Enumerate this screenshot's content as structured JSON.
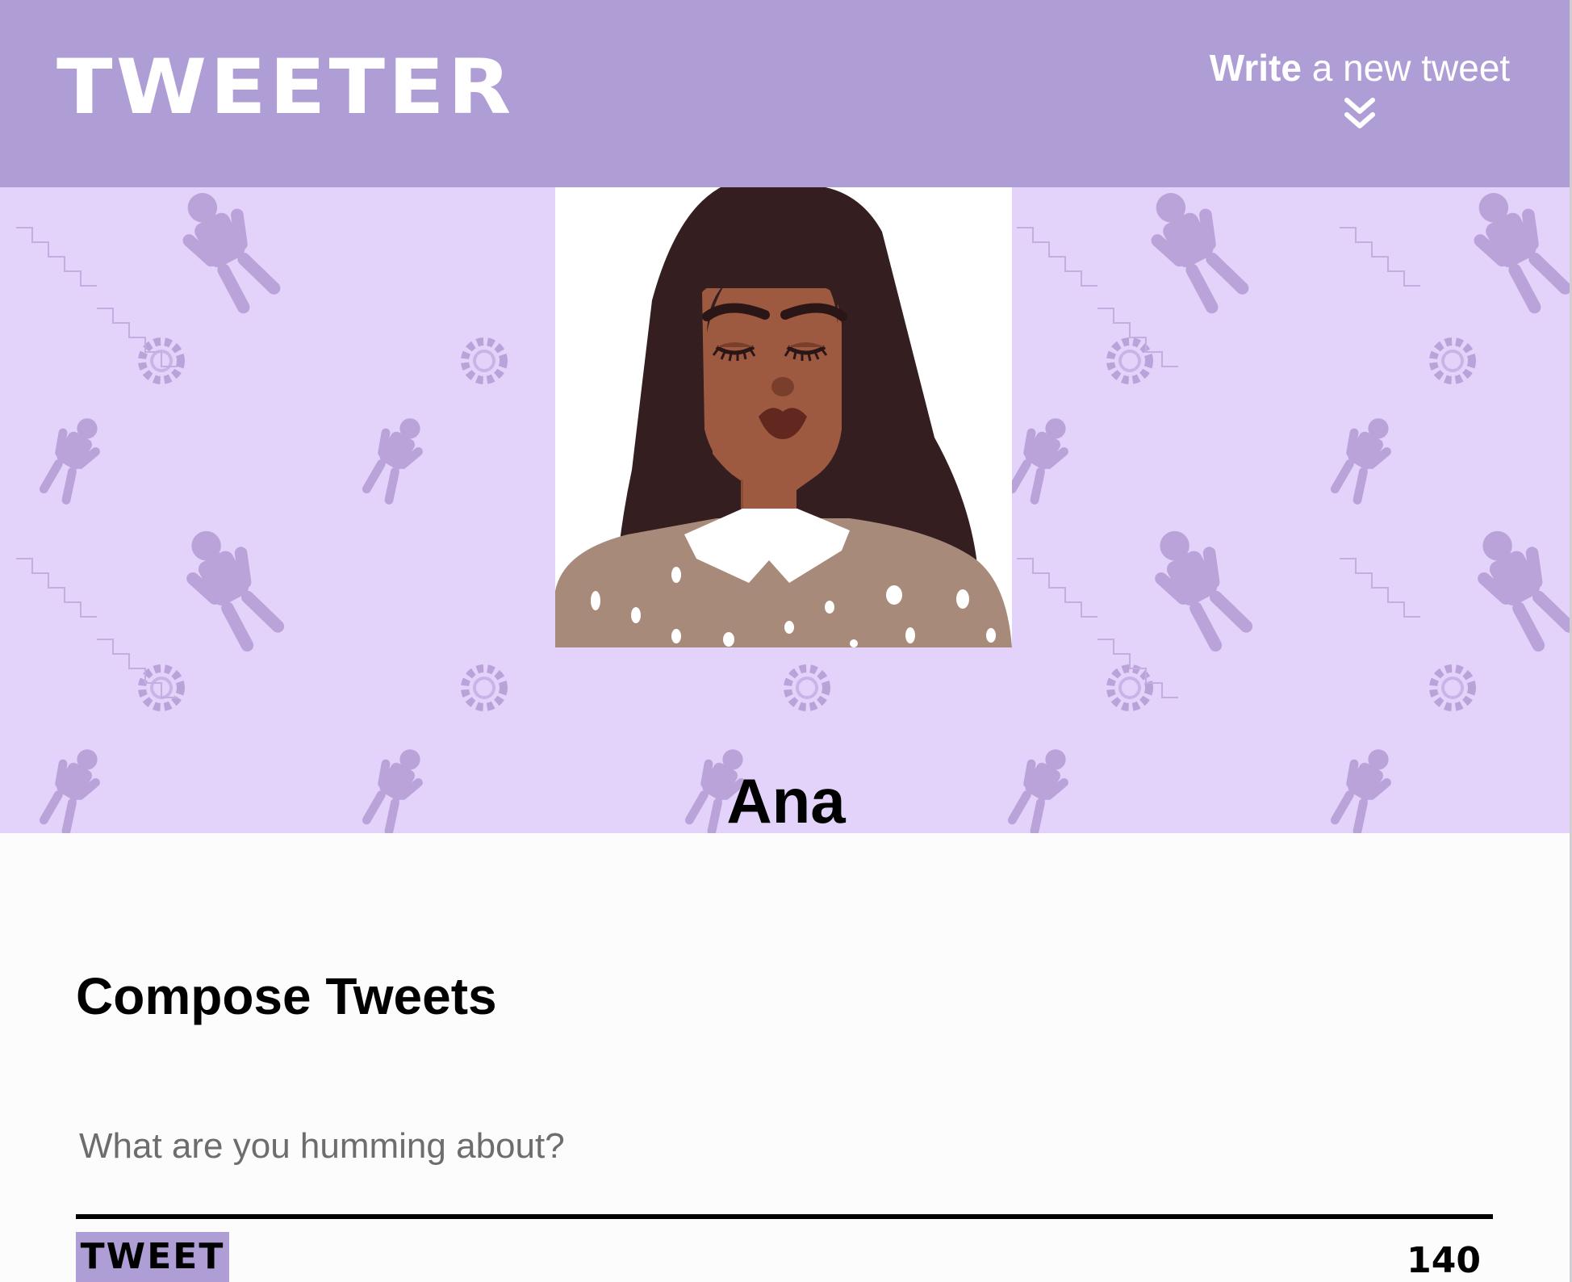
{
  "header": {
    "logo": "TWEETER",
    "write_toggle_bold": "Write",
    "write_toggle_rest": " a new tweet",
    "toggle_icon": "double-chevron-down-icon",
    "background_color": "#af9ed6"
  },
  "profile": {
    "username": "Ana",
    "avatar_icon": "profile-avatar-illustration",
    "banner_color": "#e3d3fa"
  },
  "compose": {
    "title": "Compose Tweets",
    "placeholder": "What are you humming about?",
    "value": "",
    "button_label": "TWEET",
    "char_counter": "140"
  },
  "colors": {
    "accent": "#af9ed6",
    "banner": "#e3d3fa",
    "text": "#000000",
    "placeholder": "#6d6d6d"
  }
}
